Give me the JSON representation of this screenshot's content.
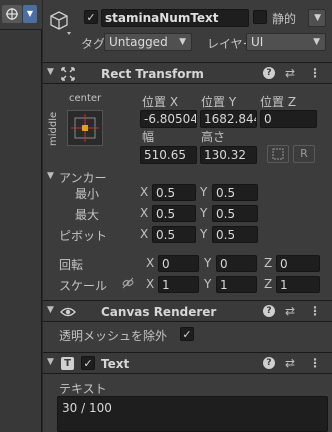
{
  "go": {
    "name": "staminaNumText",
    "static_label": "静的",
    "tag_label": "タグ",
    "tag_value": "Untagged",
    "layer_label": "レイヤー",
    "layer_value": "UI"
  },
  "rect": {
    "title": "Rect Transform",
    "anchor_preset_h": "center",
    "anchor_preset_v": "middle",
    "pos_x_label": "位置 X",
    "pos_y_label": "位置 Y",
    "pos_z_label": "位置 Z",
    "pos_x": "-6.80504",
    "pos_y": "1682.844",
    "pos_z": "0",
    "width_label": "幅",
    "height_label": "高さ",
    "width": "510.65",
    "height": "130.32",
    "r_button": "R",
    "anchors_label": "アンカー",
    "min_label": "最小",
    "max_label": "最大",
    "min_x": "0.5",
    "min_y": "0.5",
    "max_x": "0.5",
    "max_y": "0.5",
    "pivot_label": "ピボット",
    "pivot_x": "0.5",
    "pivot_y": "0.5",
    "rotation_label": "回転",
    "rot_x": "0",
    "rot_y": "0",
    "rot_z": "0",
    "scale_label": "スケール",
    "scale_x": "1",
    "scale_y": "1",
    "scale_z": "1",
    "x": "X",
    "y": "Y",
    "z": "Z"
  },
  "canvas_renderer": {
    "title": "Canvas Renderer",
    "cull_label": "透明メッシュを除外"
  },
  "text": {
    "title": "Text",
    "text_label": "テキスト",
    "text_value": "30 / 100"
  },
  "icons": {
    "check": "✓",
    "help": "?",
    "settings": "⇄",
    "more": "⋮",
    "eye": "👁",
    "link": "⛓"
  }
}
